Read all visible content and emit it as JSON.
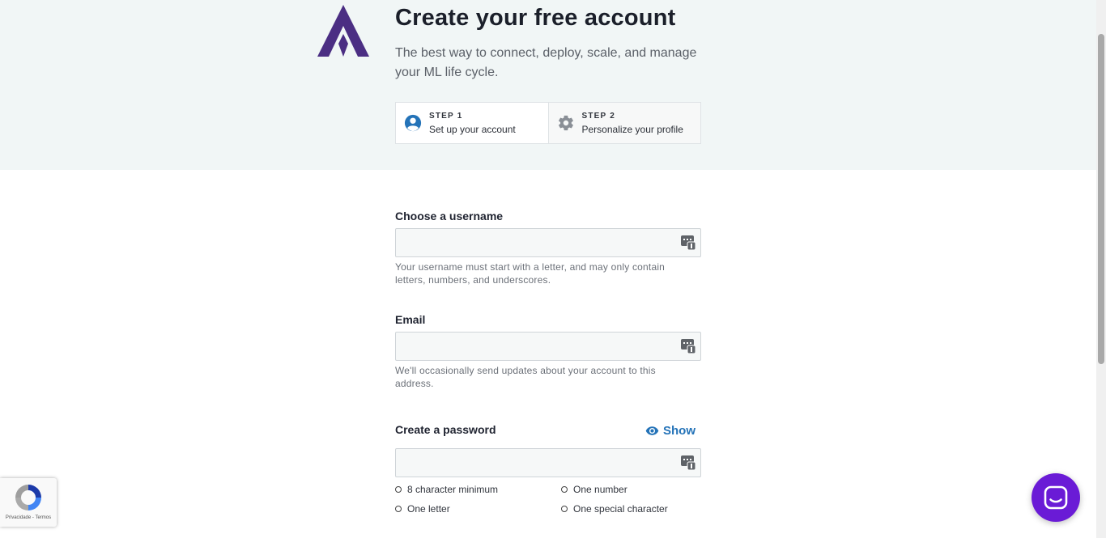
{
  "header": {
    "title": "Create your free account",
    "subtitle": "The best way to connect, deploy, scale, and manage your ML life cycle."
  },
  "steps": [
    {
      "number": "STEP 1",
      "label": "Set up your account",
      "icon": "user-circle-icon",
      "active": true
    },
    {
      "number": "STEP 2",
      "label": "Personalize your profile",
      "icon": "gear-icon",
      "active": false
    }
  ],
  "form": {
    "username": {
      "label": "Choose a username",
      "value": "",
      "help": "Your username must start with a letter, and may only contain letters, numbers, and underscores."
    },
    "email": {
      "label": "Email",
      "value": "",
      "help": "We'll occasionally send updates about your account to this address."
    },
    "password": {
      "label": "Create a password",
      "value": "",
      "toggle_label": "Show",
      "requirements": [
        "8 character minimum",
        "One number",
        "One letter",
        "One special character"
      ]
    }
  },
  "recaptcha": {
    "links": "Privacidade - Termos"
  },
  "colors": {
    "brand": "#4b2e83",
    "link": "#2473b8",
    "chat": "#6a1bd6",
    "hero_bg": "#f1f6f6"
  }
}
